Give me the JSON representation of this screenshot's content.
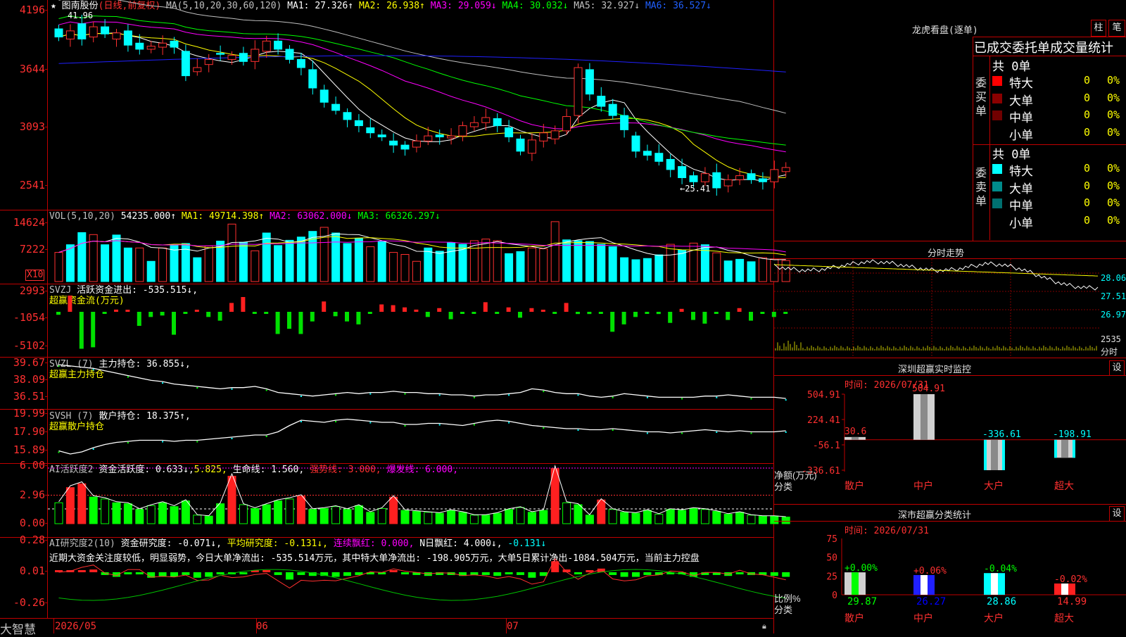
{
  "app": {
    "brand": "大智慧"
  },
  "stock": {
    "name": "图南股份",
    "period": "(日线,前复权)"
  },
  "main_chart": {
    "ma_label": "MA(5,10,20,30,60,120)",
    "ma1": "MA1: 27.326↑",
    "ma2": "MA2: 26.938↑",
    "ma3": "MA3: 29.059↓",
    "ma4": "MA4: 30.032↓",
    "ma5": "MA5: 32.927↓",
    "ma6": "MA6: 36.527↓",
    "y_ticks": [
      "4196",
      "3644",
      "3093",
      "2541"
    ],
    "high_note": "41.96",
    "low_note": "←25.41",
    "colors": {
      "ma1": "#ffffff",
      "ma2": "#ffff00",
      "ma3": "#ff00ff",
      "ma4": "#00ff00",
      "ma5": "#c0c0c0",
      "ma6": "#2020ff",
      "up": "#ff3030",
      "down": "#00ffff"
    }
  },
  "chart_data": [
    {
      "type": "bar",
      "title": "VOL(5,10,20)",
      "summary": "54235.000↑",
      "ma1": "MA1: 49714.398↑",
      "ma2": "MA2: 63062.000↓",
      "ma3": "MA3: 66326.297↓",
      "y_ticks": [
        "14624",
        "7222"
      ],
      "unit_badge": "X10",
      "values": [
        7200,
        9100,
        12100,
        11600,
        9100,
        11500,
        8300,
        8300,
        5000,
        8300,
        9000,
        9400,
        5900,
        8800,
        10000,
        14200,
        9700,
        7600,
        12000,
        8900,
        10200,
        11000,
        12400,
        13400,
        12000,
        9400,
        10700,
        8600,
        9900,
        7200,
        6700,
        5000,
        8300,
        7500,
        9600,
        9200,
        10100,
        10500,
        10100,
        6900,
        7400,
        8300,
        8100,
        14800,
        10300,
        10100,
        9900,
        9200,
        8600,
        5900,
        5400,
        5700,
        6600,
        9200,
        7800,
        9500,
        9100,
        7100,
        5100,
        5500,
        4900,
        5900,
        5600,
        5200
      ]
    },
    {
      "type": "bar",
      "title": "SVZJ",
      "label1": "活跃资金进出: -535.515↓,",
      "label2": "超赢资金流(万元)",
      "y_ticks": [
        "2993",
        "-1054",
        "-5102"
      ],
      "values": [
        -400,
        2200,
        -5000,
        -4800,
        -100,
        300,
        0,
        -1900,
        -700,
        -500,
        -3100,
        -200,
        0,
        -700,
        -1200,
        1200,
        2000,
        -100,
        -100,
        -3000,
        -2300,
        -3000,
        -1300,
        1400,
        -600,
        -1300,
        -1700,
        -200,
        1000,
        900,
        600,
        300,
        -700,
        500,
        -1000,
        -100,
        -100,
        1300,
        -100,
        600,
        -800,
        500,
        100,
        -100,
        1200,
        -300,
        -300,
        -100,
        -2700,
        -1700,
        -700,
        -100,
        -300,
        -1500,
        400,
        -1100,
        -1600,
        -100,
        -1100,
        500,
        -1200,
        -100,
        -700,
        -200
      ]
    },
    {
      "type": "line",
      "title": "SVZL (7)",
      "label1": "主力持仓: 36.855↓,",
      "label2": "超赢主力持仓",
      "y_ticks": [
        "39.67",
        "38.09",
        "36.51"
      ],
      "values": [
        39.6,
        39.5,
        39.4,
        39.3,
        39.1,
        38.9,
        38.7,
        38.5,
        38.3,
        38.2,
        38.0,
        37.9,
        37.8,
        37.7,
        37.6,
        37.7,
        37.7,
        37.8,
        37.6,
        37.3,
        37.2,
        37.1,
        37.0,
        37.1,
        37.2,
        37.3,
        37.2,
        37.3,
        37.3,
        37.4,
        37.3,
        37.3,
        37.2,
        37.2,
        37.1,
        37.1,
        37.0,
        37.1,
        37.1,
        37.2,
        37.3,
        37.6,
        37.5,
        37.3,
        37.2,
        37.2,
        37.0,
        36.9,
        37.0,
        37.2,
        37.1,
        37.0,
        36.9,
        36.9,
        36.9,
        36.9,
        37.0,
        37.0,
        37.1,
        37.0,
        36.9,
        36.9,
        36.9,
        36.8
      ]
    },
    {
      "type": "line",
      "title": "SVSH (7)",
      "label1": "散户持仓: 18.375↑,",
      "label2": "超赢散户持仓",
      "y_ticks": [
        "19.99",
        "17.90",
        "15.89"
      ],
      "values": [
        16.5,
        16.2,
        16.4,
        16.8,
        17.1,
        17.3,
        17.4,
        17.5,
        17.5,
        17.5,
        17.4,
        17.5,
        17.5,
        17.6,
        17.7,
        17.8,
        17.9,
        18.0,
        18.0,
        18.3,
        18.9,
        19.4,
        19.3,
        19.2,
        19.4,
        19.5,
        19.4,
        19.3,
        19.2,
        19.2,
        19.0,
        19.0,
        19.1,
        19.1,
        19.0,
        18.9,
        19.1,
        19.3,
        19.4,
        19.3,
        19.1,
        18.9,
        18.8,
        18.7,
        18.6,
        18.6,
        18.5,
        18.5,
        18.6,
        18.5,
        18.4,
        18.3,
        18.3,
        18.2,
        18.3,
        18.4,
        18.5,
        18.4,
        18.3,
        18.4,
        18.3,
        18.3,
        18.3,
        18.4
      ]
    },
    {
      "type": "bar",
      "title": "AI活跃度2",
      "label1": "资金活跃度: 0.633↓,",
      "label2": "5.825,",
      "label3": "生命线: 1.560,",
      "label4": "强势线: 3.000,",
      "label5": "爆发线: 6.000,",
      "y_ticks": [
        "6.00",
        "2.96",
        "0.00"
      ],
      "values": [
        2.2,
        3.8,
        4.2,
        2.8,
        2.6,
        2.2,
        2.1,
        1.5,
        1.9,
        2.2,
        1.8,
        2.4,
        0.9,
        0.8,
        2.1,
        5.0,
        2.0,
        1.6,
        2.0,
        2.4,
        2.6,
        2.9,
        1.5,
        1.6,
        1.8,
        1.5,
        1.9,
        1.2,
        1.6,
        2.8,
        1.4,
        1.3,
        1.2,
        1.1,
        1.4,
        1.2,
        0.9,
        0.9,
        1.1,
        1.5,
        1.7,
        1.2,
        1.4,
        5.8,
        2.2,
        2.0,
        0.9,
        2.5,
        1.5,
        1.2,
        1.1,
        1.4,
        1.0,
        1.5,
        1.4,
        1.6,
        1.5,
        1.3,
        1.0,
        1.2,
        0.9,
        0.8,
        0.8,
        0.7
      ]
    },
    {
      "type": "bar",
      "title": "AI研究度2(10)",
      "label1": "资金研究度: -0.071↓,",
      "label2": "平均研究度: -0.131↓,",
      "label3": "连续飘红: 0.000,",
      "label4": "N日飘红: 4.000↓,",
      "label5": "-0.131↓",
      "note": "近期大资金关注度较低，明显弱势，今日大单净流出: -535.514万元，其中特大单净流出: -198.905万元，大单5日累计净出-1084.504万元，当前主力控盘",
      "y_ticks": [
        "0.28",
        "0.01",
        "-0.26"
      ],
      "values": [
        0.0,
        0.0,
        0.02,
        0.03,
        -0.03,
        -0.05,
        -0.01,
        -0.01,
        -0.06,
        -0.05,
        -0.05,
        -0.03,
        -0.06,
        -0.05,
        -0.01,
        -0.02,
        -0.01,
        0.01,
        0.02,
        -0.03,
        -0.08,
        -0.03,
        -0.04,
        -0.04,
        -0.05,
        -0.04,
        -0.03,
        -0.01,
        -0.02,
        0.0,
        -0.02,
        -0.03,
        -0.04,
        -0.03,
        -0.03,
        -0.04,
        -0.03,
        -0.03,
        -0.04,
        -0.02,
        -0.03,
        -0.06,
        -0.04,
        0.12,
        0.03,
        -0.02,
        0.02,
        0.04,
        -0.03,
        -0.05,
        -0.05,
        -0.03,
        -0.03,
        -0.01,
        -0.02,
        -0.05,
        -0.03,
        -0.03,
        -0.04,
        -0.01,
        -0.03,
        -0.03,
        -0.04,
        -0.05
      ]
    },
    {
      "type": "bar",
      "title": "深圳超赢实时监控",
      "date": "时间: 2026/07/31",
      "y_ticks": [
        "504.91",
        "224.41",
        "-56.1",
        "-336.61"
      ],
      "y_label": "净额(万元)",
      "x_label": "分类",
      "categories": [
        "散户",
        "中户",
        "大户",
        "超大"
      ],
      "values": [
        30.6,
        504.91,
        -336.61,
        -198.91
      ],
      "value_labels": [
        "30.6",
        "504.91",
        "-336.61",
        "-198.91"
      ]
    },
    {
      "type": "bar",
      "title": "深市超赢分类统计",
      "date": "时间: 2026/07/31",
      "y_ticks": [
        "75",
        "50",
        "25",
        "0"
      ],
      "y_label": "比例%",
      "x_label": "分类",
      "categories": [
        "散户",
        "中户",
        "大户",
        "超大"
      ],
      "values": [
        29.87,
        26.27,
        28.86,
        14.99
      ],
      "changes": [
        "+0.00%",
        "+0.06%",
        "-0.04%",
        "-0.02%"
      ]
    }
  ],
  "x_axis": {
    "labels": [
      "2026/05",
      "06",
      "07"
    ]
  },
  "right_panel": {
    "lhb_title": "龙虎看盘(逐单)",
    "btn_zhu": "柱",
    "btn_bi": "笔",
    "tabs": "已成交委托单成交量统计",
    "buy": {
      "side": [
        "委",
        "买",
        "单"
      ],
      "total": "共 0单",
      "rows": [
        {
          "label": "特大",
          "count": "0",
          "pct": "0%"
        },
        {
          "label": "大单",
          "count": "0",
          "pct": "0%"
        },
        {
          "label": "中单",
          "count": "0",
          "pct": "0%"
        },
        {
          "label": "小单",
          "count": "0",
          "pct": "0%"
        }
      ]
    },
    "sell": {
      "side": [
        "委",
        "卖",
        "单"
      ],
      "total": "共 0单",
      "rows": [
        {
          "label": "特大",
          "count": "0",
          "pct": "0%"
        },
        {
          "label": "大单",
          "count": "0",
          "pct": "0%"
        },
        {
          "label": "中单",
          "count": "0",
          "pct": "0%"
        },
        {
          "label": "小单",
          "count": "0",
          "pct": "0%"
        }
      ]
    },
    "intraday": {
      "title": "分时走势",
      "y_ticks": [
        "28.06",
        "27.51",
        "26.97"
      ],
      "vol_tick": "2535",
      "vol_unit": "分时"
    },
    "set_btn": "设"
  }
}
